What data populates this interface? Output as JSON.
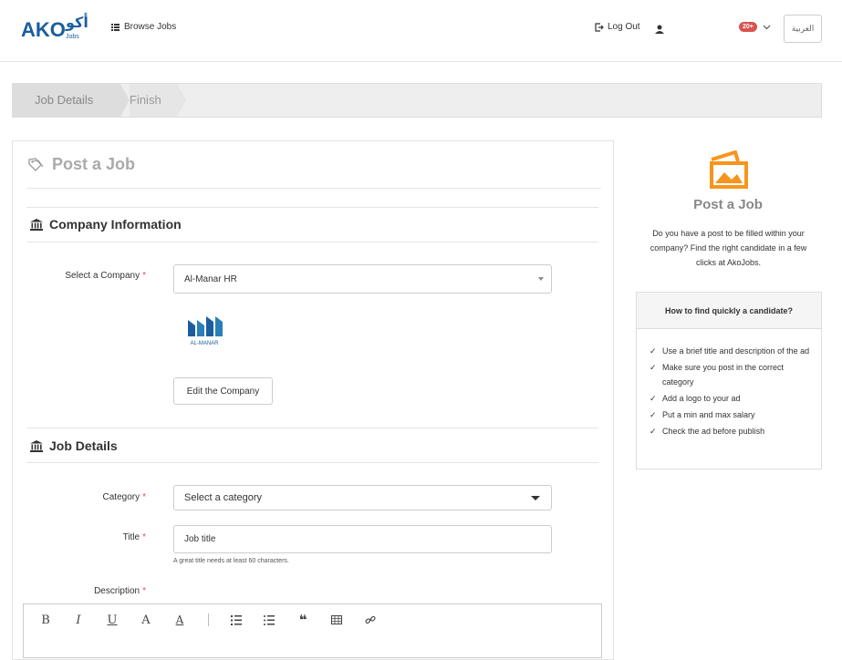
{
  "header": {
    "logo_text": "AKO",
    "logo_arabic": "أكو",
    "logo_sub": "Jobs",
    "browse_jobs": "Browse Jobs",
    "log_out": "Log Out",
    "notifications_badge": "20+",
    "language_button": "العربية"
  },
  "wizard": {
    "steps": [
      {
        "label": "Job Details",
        "active": true
      },
      {
        "label": "Finish",
        "active": false
      }
    ]
  },
  "form": {
    "title": "Post a Job",
    "company_section": "Company Information",
    "select_company_label": "Select a Company",
    "company_value": "Al-Manar HR",
    "company_logo_text": "AL-MANAR",
    "edit_company_button": "Edit the Company",
    "job_section": "Job Details",
    "category_label": "Category",
    "category_value": "Select a category",
    "title_label": "Title",
    "title_placeholder": "Job title",
    "title_hint": "A great title needs at least 60 characters.",
    "description_label": "Description",
    "required_mark": "*"
  },
  "sidebar": {
    "title": "Post a Job",
    "description": "Do you have a post to be filled within your company? Find the right candidate in a few clicks at AkoJobs.",
    "tips_title": "How to find quickly a candidate?",
    "tips": [
      "Use a brief title and description of the ad",
      "Make sure you post in the correct category",
      "Add a logo to your ad",
      "Put a min and max salary",
      "Check the ad before publish"
    ],
    "check_mark": "✓"
  },
  "colors": {
    "accent_orange": "#f7941d",
    "logo_blue": "#1b5e9e",
    "badge_red": "#d9534f"
  }
}
